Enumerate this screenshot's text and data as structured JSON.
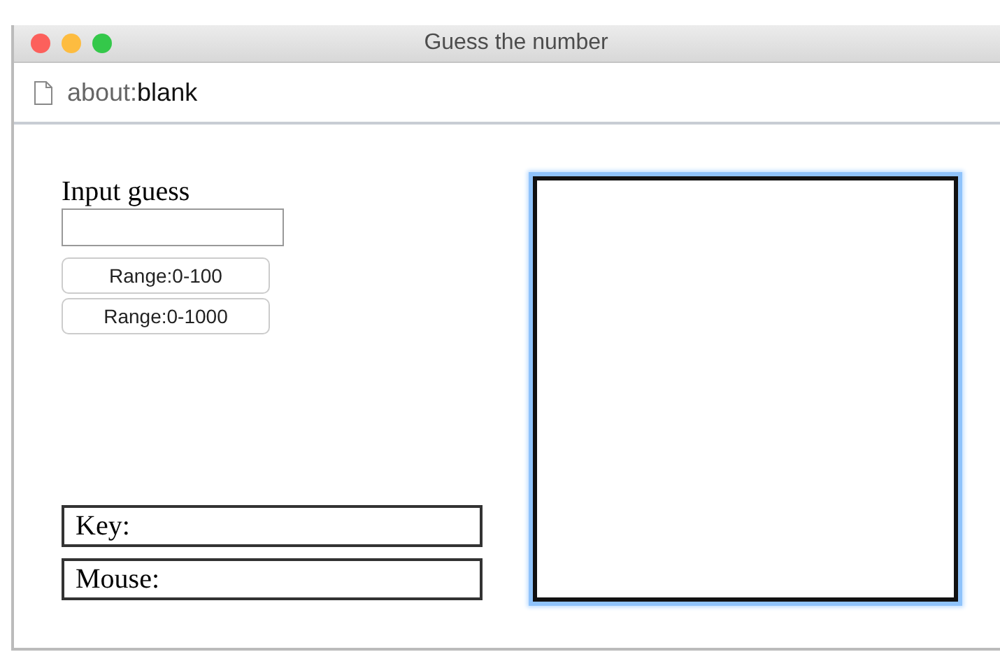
{
  "window": {
    "title": "Guess the number"
  },
  "address": {
    "scheme": "about:",
    "rest": "blank"
  },
  "form": {
    "label": "Input guess",
    "buttons": [
      "Range:0-100",
      "Range:0-1000"
    ]
  },
  "readouts": [
    "Key:",
    "Mouse:"
  ],
  "canvas": {
    "focused": true
  }
}
